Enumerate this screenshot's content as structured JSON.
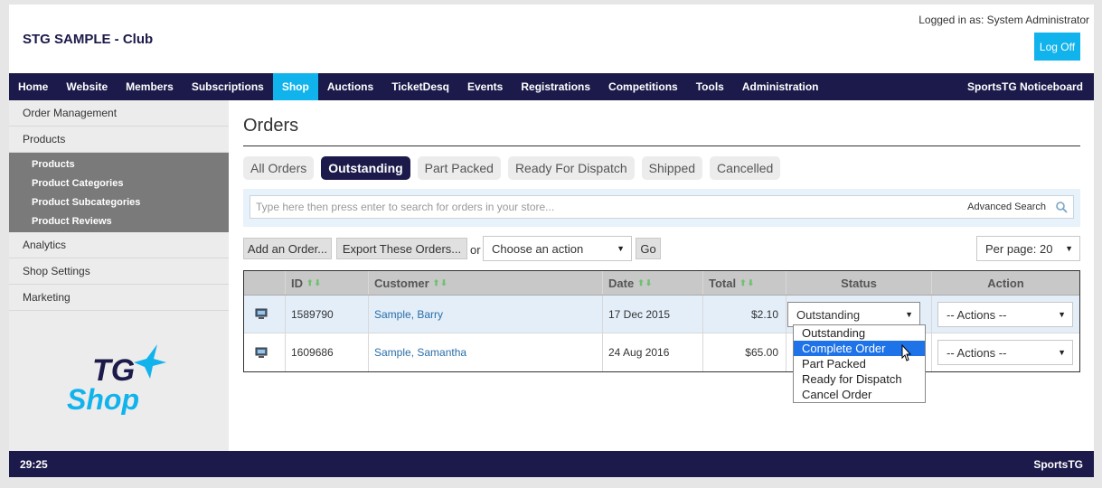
{
  "header": {
    "club_title": "STG SAMPLE - Club",
    "logged_in": "Logged in as: System Administrator",
    "logoff_label": "Log Off"
  },
  "nav": {
    "items": [
      "Home",
      "Website",
      "Members",
      "Subscriptions",
      "Shop",
      "Auctions",
      "TicketDesq",
      "Events",
      "Registrations",
      "Competitions",
      "Tools",
      "Administration"
    ],
    "active": "Shop",
    "right_label": "SportsTG Noticeboard"
  },
  "sidebar": {
    "items": [
      {
        "label": "Order Management"
      },
      {
        "label": "Products"
      }
    ],
    "sub_items": [
      "Products",
      "Product Categories",
      "Product Subcategories",
      "Product Reviews"
    ],
    "items_after": [
      {
        "label": "Analytics"
      },
      {
        "label": "Shop Settings"
      },
      {
        "label": "Marketing"
      }
    ],
    "logo_text_1": "TG",
    "logo_text_2": "Shop"
  },
  "main": {
    "title": "Orders",
    "tabs": [
      "All Orders",
      "Outstanding",
      "Part Packed",
      "Ready For Dispatch",
      "Shipped",
      "Cancelled"
    ],
    "active_tab": "Outstanding",
    "search": {
      "placeholder": "Type here then press enter to search for orders in your store...",
      "advanced_label": "Advanced Search"
    },
    "toolbar": {
      "add_order": "Add an Order...",
      "export_orders": "Export These Orders...",
      "or": "or",
      "action_select": "Choose an action",
      "go": "Go",
      "per_page": "Per page: 20"
    },
    "table": {
      "headers": [
        "ID",
        "Customer",
        "Date",
        "Total",
        "Status",
        "Action"
      ],
      "rows": [
        {
          "id": "1589790",
          "customer": "Sample, Barry",
          "date": "17 Dec 2015",
          "total": "$2.10",
          "status": "Outstanding",
          "action": "-- Actions --"
        },
        {
          "id": "1609686",
          "customer": "Sample, Samantha",
          "date": "24 Aug 2016",
          "total": "$65.00",
          "status": "",
          "action": "-- Actions --"
        }
      ]
    },
    "status_dropdown": {
      "options": [
        "Outstanding",
        "Complete Order",
        "Part Packed",
        "Ready for Dispatch",
        "Cancel Order"
      ],
      "highlighted": "Complete Order"
    }
  },
  "footer": {
    "left": "29:25",
    "right": "SportsTG"
  },
  "colors": {
    "nav_bg": "#1b1a4a",
    "accent": "#11b3ec",
    "link": "#2a6ea8",
    "highlight": "#1e73e8"
  }
}
